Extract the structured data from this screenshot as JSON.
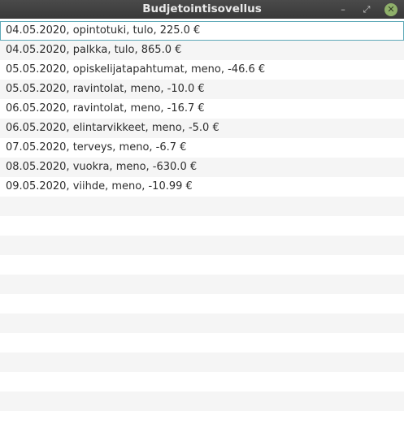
{
  "window": {
    "title": "Budjetointisovellus",
    "minimize_glyph": "–",
    "maximize_glyph": "⤢",
    "close_glyph": "✕"
  },
  "entries": [
    {
      "text": "04.05.2020, opintotuki, tulo, 225.0 €",
      "selected": true
    },
    {
      "text": "04.05.2020, palkka, tulo, 865.0 €"
    },
    {
      "text": "05.05.2020, opiskelijatapahtumat, meno, -46.6 €"
    },
    {
      "text": "05.05.2020, ravintolat, meno, -10.0 €"
    },
    {
      "text": "06.05.2020, ravintolat, meno, -16.7 €"
    },
    {
      "text": "06.05.2020, elintarvikkeet, meno, -5.0 €"
    },
    {
      "text": "07.05.2020, terveys, meno, -6.7 €"
    },
    {
      "text": "08.05.2020, vuokra, meno, -630.0 €"
    },
    {
      "text": "09.05.2020, viihde, meno, -10.99 €"
    }
  ],
  "empty_row_count": 12,
  "colors": {
    "titlebar": "#3f3f3f",
    "selection_border": "#5fa9b8",
    "row_stripe": "#f5f5f5",
    "close_button": "#8fb06a"
  }
}
